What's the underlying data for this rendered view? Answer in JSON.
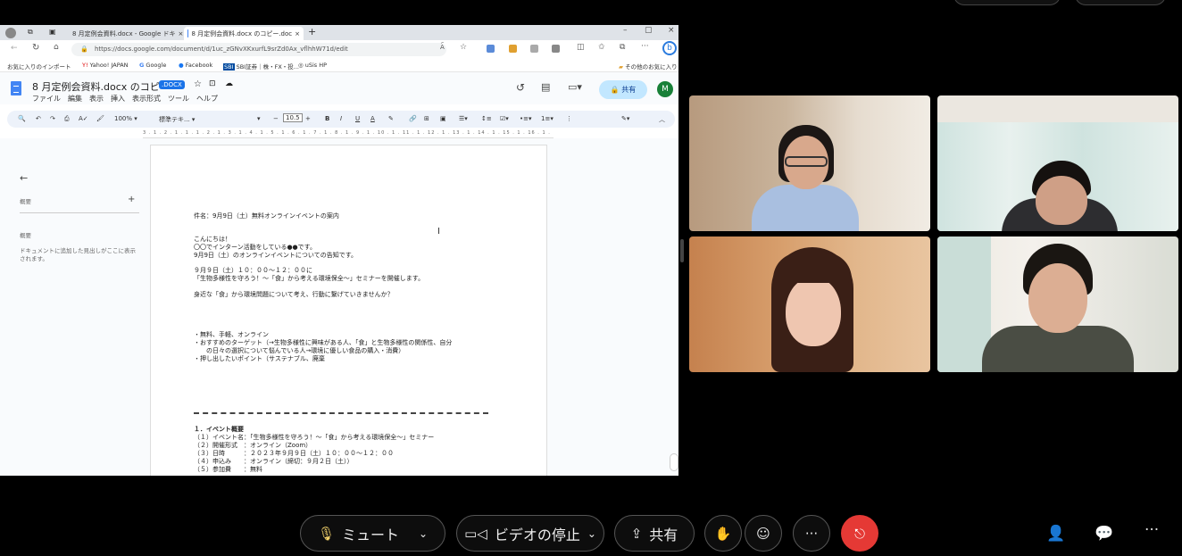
{
  "browser": {
    "tabs": [
      {
        "label": "8 月定例会資料.docx - Google ドキ"
      },
      {
        "label": "8 月定例会資料.docx のコピー.doc"
      }
    ],
    "new_tab": "+",
    "url": "https://docs.google.com/document/d/1uc_zGNvXKxurfL9srZd0Ax_vflhhW71d/edit",
    "bookmarks": [
      "お気に入りのインポート",
      "Yahoo! JAPAN",
      "Google",
      "Facebook",
      "SBI証券｜株・FX・投...",
      "uSis HP",
      "その他のお気に入り"
    ]
  },
  "docs": {
    "title": "8 月定例会資料.docx のコピー",
    "badge": ".DOCX",
    "menus": [
      "ファイル",
      "編集",
      "表示",
      "挿入",
      "表示形式",
      "ツール",
      "ヘルプ"
    ],
    "share_label": "共有",
    "avatar_letter": "M",
    "toolbar": {
      "zoom": "100%",
      "style": "標準テキ...",
      "font_size": "10.5"
    },
    "ruler": "3 . 1 . 2 . 1 . 1 . 1 . 2 . 1 . 3 . 1 . 4 . 1 . 5 . 1 . 6 . 1 . 7 . 1 . 8 . 1 . 9 . 1 . 10 . 1 . 11 . 1 . 12 . 1 . 13 . 1 . 14 . 1 . 15 . 1 . 16 . 1 . 17 . 1 . 18",
    "outline": {
      "summary_label": "概要",
      "headings_label": "概要",
      "hint": "ドキュメントに追加した見出しがここに表示されます。"
    },
    "body": {
      "subject": "件名：9月9日（土）無料オンラインイベントの案内",
      "greeting": "こんにちは！",
      "intro1": "〇〇でインターン活動をしている●●です。",
      "intro2": "9月9日（土）のオンラインイベントについての告知です。",
      "datetime": "９月９日（土）１０：００〜１２：００に",
      "seminar": "「生物多様性を守ろう！〜「食」から考える環境保全〜」セミナーを開催します。",
      "invite": "身近な「食」から環境問題について考え、行動に繋げていきませんか？",
      "bullet1": "・無料、手軽、オンライン",
      "bullet2a": "・おすすめのターゲット（→生物多様性に興味がある人、「食」と生物多様性の関係性、自分",
      "bullet2b": "の日々の選択について悩んでいる人→環境に優しい食品の購入・消費）",
      "bullet3": "・押し出したいポイント（サステナブル、廃棄",
      "section": "１．イベント概要",
      "item1": "（１）イベント名：「生物多様性を守ろう！〜「食」から考える環境保全〜」セミナー",
      "item2": "（２）開催形式　：オンライン（Zoom）",
      "item3": "（３）日時　　　：２０２３年９月９日（土）１０：００〜１２：００",
      "item4": "（４）申込み　　：オンライン（締切：９月２日（土））",
      "item5": "（５）参加費　　：無料"
    }
  },
  "controls": {
    "mute_label": "ミュート",
    "video_label": "ビデオの停止",
    "share_label": "共有",
    "more": "···"
  },
  "colors": {
    "end_call": "#e53935",
    "docs_blue": "#1a73e8",
    "share_pill": "#c2e7ff"
  }
}
